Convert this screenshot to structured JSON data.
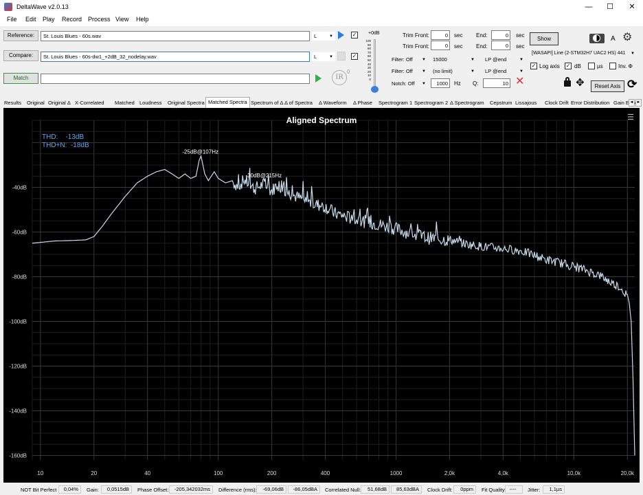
{
  "app": {
    "title": "DeltaWave v2.0.13",
    "min": "—",
    "max": "☐",
    "close": "✕"
  },
  "menu": [
    "File",
    "Edit",
    "Play",
    "Record",
    "Process",
    "View",
    "Help"
  ],
  "files": {
    "reference_label": "Reference:",
    "reference_value": "St. Louis Blues - 60s.wav",
    "compare_label": "Compare:",
    "compare_value": "St. Louis Blues - 60s-dw1_+2dB_32_nodelay.wav",
    "match_label": "Match",
    "channel_ref": "L",
    "channel_cmp": "L"
  },
  "ir": {
    "label": "IR",
    "exp": "0"
  },
  "volume": {
    "label": "+0dB",
    "ticks": [
      "100",
      "90",
      "80",
      "70",
      "60",
      "50",
      "40",
      "30",
      "20",
      "10",
      "0"
    ]
  },
  "trim": {
    "front_label": "Trim Front:",
    "front1": "0",
    "end_label": "End:",
    "end1": "0",
    "sec": "sec",
    "front2": "0",
    "end2": "0"
  },
  "filters": {
    "filter1": "Filter: Off",
    "freq1": "15000",
    "lp1": "LP @end",
    "filter2": "Filter: Off",
    "freq2": "(no limit)",
    "lp2": "LP @end",
    "notch": "Notch: Off",
    "notch_freq": "1000",
    "hz": "Hz",
    "q_label": "Q:",
    "q_value": "10"
  },
  "right": {
    "show": "Show",
    "a": "A",
    "device": "[WASAPI] Line (2-STM32H7 UAC2 HS) 441",
    "log_axis": "Log axis",
    "db": "dB",
    "us": "µs",
    "inv": "Inv. Φ",
    "reset": "Reset Axis"
  },
  "tabs": [
    "Results",
    "Original",
    "Original Δ",
    "X-Correlated",
    "Matched",
    "Loudness",
    "Original Spectra",
    "Matched Spectra",
    "Spectrum of Δ",
    "Δ of Spectra",
    "Δ Waveform",
    "Δ Phase",
    "Spectrogram 1",
    "Spectrogram 2",
    "Δ Spectrogram",
    "Cepstrum",
    "Lissajous",
    "Clock Drift",
    "Error Distribution",
    "Gain Error"
  ],
  "active_tab": "Matched Spectra",
  "chart_data": {
    "type": "line",
    "title": "Aligned Spectrum",
    "xscale": "log",
    "xlim": [
      9,
      22000
    ],
    "ylim": [
      -162,
      -10
    ],
    "yticks": [
      -40,
      -60,
      -80,
      -100,
      -120,
      -140,
      -160
    ],
    "ytick_labels": [
      "-40dB",
      "-60dB",
      "-80dB",
      "-100dB",
      "-120dB",
      "-140dB",
      "-160dB"
    ],
    "xticks": [
      10,
      20,
      40,
      100,
      200,
      400,
      1000,
      2000,
      4000,
      10000,
      20000
    ],
    "xtick_labels": [
      "10",
      "20",
      "40",
      "100",
      "200",
      "400",
      "1000",
      "2,0k",
      "4,0k",
      "10,0k",
      "20,0k"
    ],
    "annotations": [
      {
        "text": "THD:    -13dB"
      },
      {
        "text": "THD+N:  -18dB"
      },
      {
        "text": "-30dB@215Hz",
        "x": 140,
        "y": -35.5
      },
      {
        "text": "-25dB@107Hz",
        "x": 82,
        "y": -25.5
      }
    ],
    "series": [
      {
        "color": "#c8dcec",
        "x": [
          9,
          12,
          15,
          18,
          20,
          22,
          25,
          30,
          35,
          40,
          45,
          50,
          55,
          60,
          65,
          70,
          75,
          78,
          80,
          82,
          84,
          88,
          95,
          100,
          110,
          120,
          130,
          140,
          160,
          180,
          200,
          215,
          250,
          300,
          350,
          400,
          450,
          500,
          600,
          700,
          800,
          1000,
          1200,
          1500,
          2000,
          2500,
          3000,
          4000,
          5000,
          6000,
          7000,
          8000,
          10000,
          12000,
          14000,
          16000,
          18000,
          19000,
          20000,
          20500,
          21000,
          21500,
          22000
        ],
        "y": [
          -65,
          -64,
          -63.8,
          -63.5,
          -62,
          -58,
          -52,
          -44,
          -38,
          -35,
          -33,
          -32,
          -34,
          -36,
          -34,
          -36,
          -35,
          -28,
          -26,
          -30,
          -34,
          -37,
          -33,
          -36,
          -38,
          -37,
          -39,
          -36,
          -40,
          -38,
          -41,
          -38,
          -42,
          -45,
          -47,
          -48,
          -51,
          -52,
          -54,
          -55,
          -56,
          -58,
          -60,
          -62,
          -63,
          -65,
          -66,
          -67,
          -68,
          -70,
          -72,
          -73,
          -75,
          -77,
          -79,
          -82,
          -84,
          -86,
          -88,
          -92,
          -100,
          -125,
          -160
        ]
      }
    ]
  },
  "status": {
    "bit": "NOT Bit Perfect",
    "bit_v": "0,04%",
    "gain_l": "Gain:",
    "gain_v": "0,0515dB",
    "phase_l": "Phase Offset:",
    "phase_v": "-205,342032ms",
    "diff_l": "Difference (rms):",
    "diff_v1": "-69,06dB",
    "diff_v2": "-86,05dBA",
    "null_l": "Correlated Null:",
    "null_v1": "51,68dB",
    "null_v2": "85,63dBA",
    "drift_l": "Clock Drift:",
    "drift_v": "0ppm",
    "fit_l": "Fit Quality:",
    "fit_v": "----",
    "jit_l": "Jitter:",
    "jit_v": "1,1µs"
  }
}
